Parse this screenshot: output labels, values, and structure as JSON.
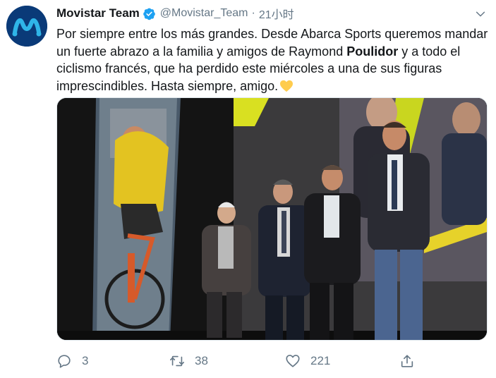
{
  "tweet": {
    "author": {
      "display_name": "Movistar Team",
      "handle": "@Movistar_Team",
      "avatar_icon": "movistar-logo-icon",
      "verified_icon": "verified-badge-icon"
    },
    "separator": "·",
    "time": "21小时",
    "text": {
      "part1": "Por siempre entre los más grandes. Desde Abarca Sports queremos mandar un fuerte abrazo a la familia y amigos de Raymond ",
      "bold": "Poulidor",
      "part2": " y a todo el ciclismo francés, que ha perdido este miércoles a una de sus figuras imprescindibles. Hasta siempre, amigo.",
      "emoji_icon": "yellow-heart-icon"
    },
    "media": {
      "type": "photo",
      "description_icon": "photo-image"
    },
    "actions": {
      "reply": {
        "icon": "reply-icon",
        "count": "3"
      },
      "retweet": {
        "icon": "retweet-icon",
        "count": "38"
      },
      "like": {
        "icon": "heart-icon",
        "count": "221"
      },
      "share": {
        "icon": "share-icon"
      }
    },
    "colors": {
      "text": "#14171a",
      "secondary": "#657786",
      "verified": "#1da1f2",
      "brand": "#0a3a78",
      "heart_emoji": "#ffcc4d"
    }
  }
}
